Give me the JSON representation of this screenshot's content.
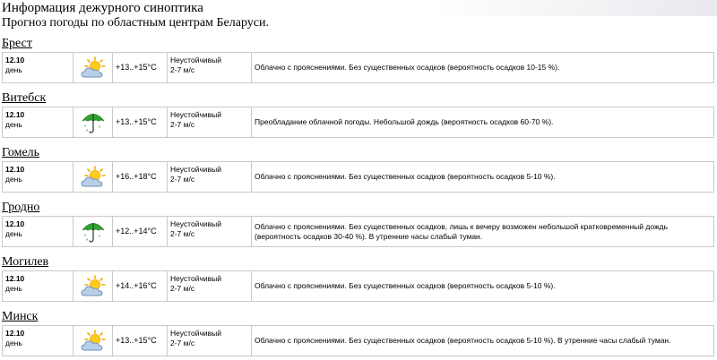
{
  "header": {
    "title": "Информация дежурного синоптика",
    "subtitle": "Прогноз погоды по областным центрам Беларуси."
  },
  "cities": [
    {
      "name": "Брест",
      "date": "12.10",
      "period": "день",
      "icon": "partly-cloudy-icon",
      "temp": "+13..+15°C",
      "wind": "Неустойчивый",
      "wind_speed": "2-7 м/с",
      "description": "Облачно с прояснениями. Без существенных осадков (вероятность осадков 10-15 %)."
    },
    {
      "name": "Витебск",
      "date": "12.10",
      "period": "день",
      "icon": "umbrella-rain-icon",
      "temp": "+13..+15°C",
      "wind": "Неустойчивый",
      "wind_speed": "2-7 м/с",
      "description": "Преобладание облачной погоды. Небольшой дождь (вероятность осадков 60-70 %)."
    },
    {
      "name": "Гомель",
      "date": "12.10",
      "period": "день",
      "icon": "partly-cloudy-icon",
      "temp": "+16..+18°C",
      "wind": "Неустойчивый",
      "wind_speed": "2-7 м/с",
      "description": "Облачно с прояснениями. Без существенных осадков (вероятность осадков 5-10 %)."
    },
    {
      "name": "Гродно",
      "date": "12.10",
      "period": "день",
      "icon": "umbrella-rain-icon",
      "temp": "+12..+14°C",
      "wind": "Неустойчивый",
      "wind_speed": "2-7 м/с",
      "description": "Облачно с прояснениями. Без существенных осадков, лишь к вечеру возможен небольшой кратковременный дождь (вероятность осадков 30-40 %). В утренние часы слабый туман."
    },
    {
      "name": "Могилев",
      "date": "12.10",
      "period": "день",
      "icon": "partly-cloudy-icon",
      "temp": "+14..+16°C",
      "wind": "Неустойчивый",
      "wind_speed": "2-7 м/с",
      "description": "Облачно с прояснениями. Без существенных осадков (вероятность осадков 5-10 %)."
    },
    {
      "name": "Минск",
      "date": "12.10",
      "period": "день",
      "icon": "partly-cloudy-icon",
      "temp": "+13..+15°C",
      "wind": "Неустойчивый",
      "wind_speed": "2-7 м/с",
      "description": "Облачно с прояснениями. Без существенных осадков (вероятность осадков 5-10 %). В утренние часы слабый туман."
    }
  ]
}
